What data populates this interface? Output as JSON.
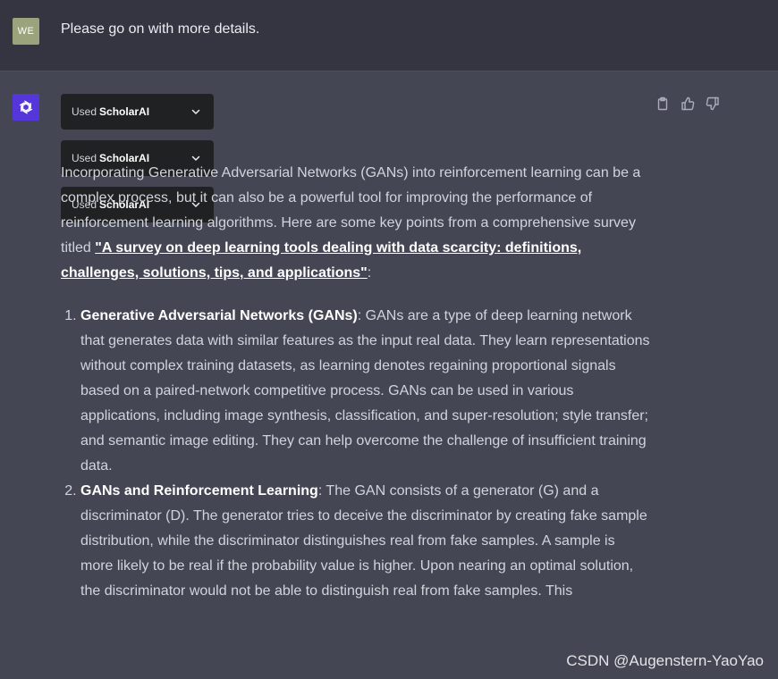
{
  "user": {
    "avatar_text": "WE",
    "message": "Please go on with more details."
  },
  "assistant": {
    "avatar_icon": "openai-logo-icon",
    "plugins": [
      {
        "used_label": "Used",
        "name": "ScholarAI"
      },
      {
        "used_label": "Used",
        "name": "ScholarAI"
      },
      {
        "used_label": "Used",
        "name": "ScholarAI"
      }
    ],
    "actions": {
      "copy_icon": "clipboard-icon",
      "like_icon": "thumbs-up-icon",
      "dislike_icon": "thumbs-down-icon"
    },
    "intro_text": "Incorporating Generative Adversarial Networks (GANs) into reinforcement learning can be a complex process, but it can also be a powerful tool for improving the performance of reinforcement learning algorithms. Here are some key points from a comprehensive survey titled ",
    "survey_link": "\"A survey on deep learning tools dealing with data scarcity: definitions, challenges, solutions, tips, and applications\"",
    "intro_suffix": ":",
    "list_items": [
      {
        "title": "Generative Adversarial Networks (GANs)",
        "body": ": GANs are a type of deep learning network that generates data with similar features as the input real data. They learn representations without complex training datasets, as learning denotes regaining proportional signals based on a paired-network competitive process. GANs can be used in various applications, including image synthesis, classification, and super-resolution; style transfer; and semantic image editing. They can help overcome the challenge of insufficient training data."
      },
      {
        "title": "GANs and Reinforcement Learning",
        "body": ": The GAN consists of a generator (G) and a discriminator (D). The generator tries to deceive the discriminator by creating fake sample distribution, while the discriminator distinguishes real from fake samples. A sample is more likely to be real if the probability value is higher. Upon nearing an optimal solution, the discriminator would not be able to distinguish real from fake samples. This"
      }
    ]
  },
  "watermark": "CSDN @Augenstern-YaoYao"
}
